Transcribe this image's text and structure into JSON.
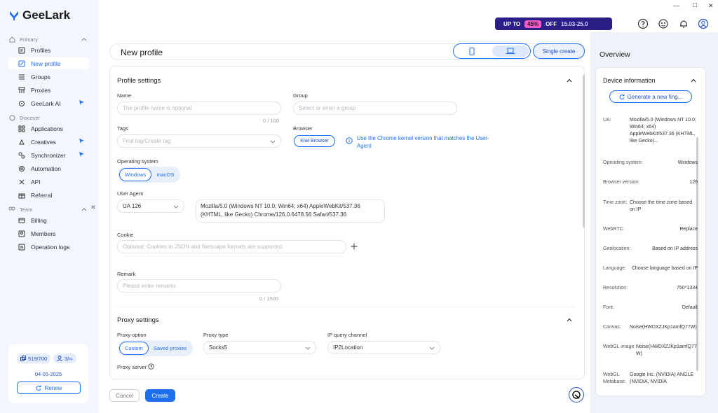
{
  "window": {
    "minimize": "—",
    "maximize": "□",
    "close": "✕"
  },
  "app": {
    "name": "GeeLark"
  },
  "sidebar": {
    "primary_label": "Primary",
    "discover_label": "Discover",
    "team_label": "Team",
    "primary_items": [
      {
        "label": "Profiles",
        "icon": "profiles-icon"
      },
      {
        "label": "New profile",
        "icon": "edit-icon",
        "active": true
      },
      {
        "label": "Groups",
        "icon": "list-icon"
      },
      {
        "label": "Proxies",
        "icon": "proxy-icon"
      },
      {
        "label": "GeeLark AI",
        "icon": "ai-icon"
      }
    ],
    "discover_items": [
      {
        "label": "Applications",
        "icon": "apps-icon"
      },
      {
        "label": "Creatives",
        "icon": "creatives-icon"
      },
      {
        "label": "Synchronizer",
        "icon": "sync-icon"
      },
      {
        "label": "Automation",
        "icon": "automation-icon"
      },
      {
        "label": "API",
        "icon": "api-icon"
      },
      {
        "label": "Referral",
        "icon": "referral-icon"
      }
    ],
    "team_items": [
      {
        "label": "Billing",
        "icon": "billing-icon"
      },
      {
        "label": "Members",
        "icon": "members-icon"
      },
      {
        "label": "Operation logs",
        "icon": "logs-icon"
      }
    ],
    "collapse": "«",
    "usage": {
      "profiles": "519/700",
      "members": "3/∞",
      "date": "04-05-2025",
      "renew": "Renew"
    }
  },
  "header": {
    "promo": {
      "prefix": "UP TO",
      "percent": "45%",
      "suffix": "OFF",
      "dates": "15.03-25.0"
    }
  },
  "main": {
    "page_title": "New profile",
    "single_create": "Single create",
    "profile_settings": {
      "title": "Profile settings",
      "name_label": "Name",
      "name_placeholder": "The profile name is optional",
      "name_count": "0 / 100",
      "group_label": "Group",
      "group_placeholder": "Select or enter a group",
      "tags_label": "Tags",
      "tags_placeholder": "Find tag/Create tag",
      "browser_label": "Browser",
      "browser_value": "Kiwi Browser",
      "browser_hint": "Use the Chrome kernel version that matches the User-Agent",
      "os_label": "Operating system",
      "os_options": [
        "Windows",
        "macOS"
      ],
      "ua_label": "User Agent",
      "ua_version": "UA 126",
      "ua_value": "Mozilla/5.0 (Windows NT 10.0; Win64; x64) AppleWebKit/537.36 (KHTML, like Gecko) Chrome/126.0.6478.56 Safari/537.36",
      "cookie_label": "Cookie",
      "cookie_placeholder": "Optional: Cookies in JSON and Netscape formats are supported.",
      "remark_label": "Remark",
      "remark_placeholder": "Please enter remarks",
      "remark_count": "0 / 1500"
    },
    "proxy_settings": {
      "title": "Proxy settings",
      "option_label": "Proxy option",
      "options": [
        "Custom",
        "Saved proxies"
      ],
      "type_label": "Proxy type",
      "type_value": "Socks5",
      "channel_label": "IP query channel",
      "channel_value": "IP2Location",
      "server_label": "Proxy server"
    },
    "cancel": "Cancel",
    "create": "Create"
  },
  "overview": {
    "title": "Overview",
    "device_info": "Device information",
    "generate": "Generate a new fing...",
    "fields": [
      {
        "k": "UA:",
        "v": "Mozilla/5.0 (Windows NT 10.0; Win64; x64) AppleWebKit/537.36 (KHTML, like Gecko)..."
      },
      {
        "k": "Operating system:",
        "v": "Windows"
      },
      {
        "k": "Browser version:",
        "v": "126"
      },
      {
        "k": "Time zone:",
        "v": "Choose the time zone based on IP"
      },
      {
        "k": "WebRTC:",
        "v": "Replace"
      },
      {
        "k": "Geolocation:",
        "v": "Based on IP address"
      },
      {
        "k": "Language:",
        "v": "Choose language based on IP"
      },
      {
        "k": "Resolution:",
        "v": "750*1334"
      },
      {
        "k": "Font:",
        "v": "Default"
      },
      {
        "k": "Canvas:",
        "v": "Noise(HWDXZJKp1amfQ77W)"
      },
      {
        "k": "WebGL image:",
        "v": "Noise(HWDXZJKp1amfQ77W)"
      },
      {
        "k": "WebGL Metabase:",
        "v": "Google Inc. (NVIDIA) ANGLE (NVIDIA, NVIDIA"
      }
    ]
  }
}
